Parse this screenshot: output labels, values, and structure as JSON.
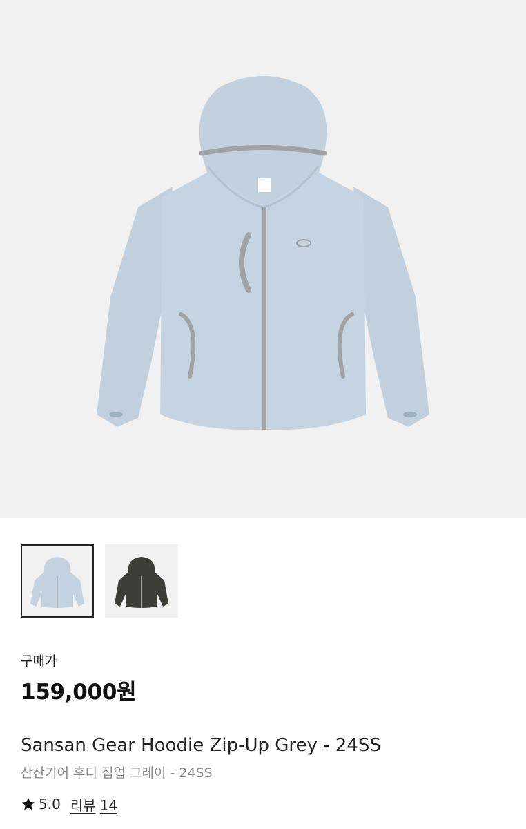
{
  "product": {
    "price_label": "구매가",
    "price": "159,000원",
    "name_en": "Sansan Gear Hoodie Zip-Up Grey - 24SS",
    "name_ko": "산산기어 후디 집업 그레이 - 24SS"
  },
  "gallery": {
    "thumbnails": [
      {
        "color": "#c4d2df",
        "selected": true
      },
      {
        "color": "#3f3d38",
        "selected": false
      }
    ]
  },
  "rating": {
    "icon": "star-icon",
    "score": "5.0",
    "review_label": "리뷰",
    "review_count": "14"
  },
  "colors": {
    "hoodie_main": "#c5d3e0",
    "trim": "#9ea3a8",
    "background": "#f1f1f1"
  }
}
